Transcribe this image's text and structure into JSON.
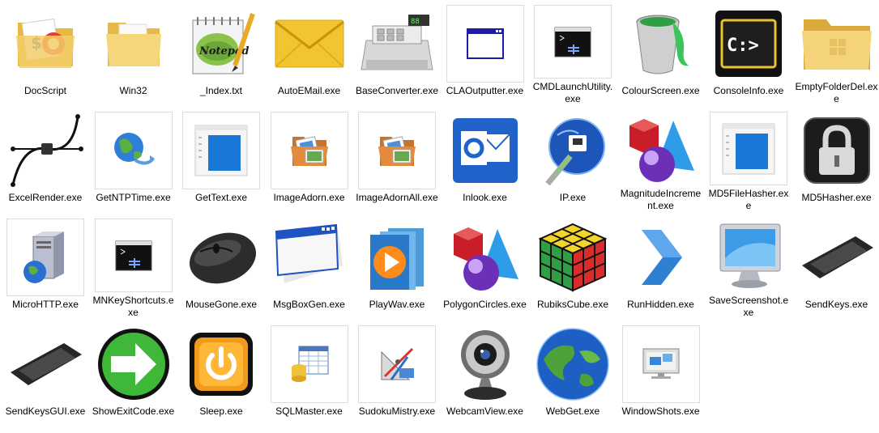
{
  "files": [
    {
      "name": "DocScript",
      "icon": "folder-with-documents-icon"
    },
    {
      "name": "Win32",
      "icon": "folder-icon"
    },
    {
      "name": "_Index.txt",
      "icon": "notepad-plus-plus-icon"
    },
    {
      "name": "AutoEMail.exe",
      "icon": "envelope-icon"
    },
    {
      "name": "BaseConverter.exe",
      "icon": "cash-register-icon"
    },
    {
      "name": "CLAOutputter.exe",
      "icon": "window-icon"
    },
    {
      "name": "CMDLaunchUtility.exe",
      "icon": "console-window-icon"
    },
    {
      "name": "ColourScreen.exe",
      "icon": "paint-bucket-icon"
    },
    {
      "name": "ConsoleInfo.exe",
      "icon": "command-prompt-icon"
    },
    {
      "name": "EmptyFolderDel.exe",
      "icon": "yellow-folder-icon"
    },
    {
      "name": "ExcelRender.exe",
      "icon": "bezier-curve-icon"
    },
    {
      "name": "GetNTPTime.exe",
      "icon": "globe-network-icon"
    },
    {
      "name": "GetText.exe",
      "icon": "application-window-icon"
    },
    {
      "name": "ImageAdorn.exe",
      "icon": "photo-folder-icon"
    },
    {
      "name": "ImageAdornAll.exe",
      "icon": "photo-folder-icon"
    },
    {
      "name": "Inlook.exe",
      "icon": "outlook-icon"
    },
    {
      "name": "IP.exe",
      "icon": "network-cable-globe-icon"
    },
    {
      "name": "MagnitudeIncrement.exe",
      "icon": "geometric-shapes-icon"
    },
    {
      "name": "MD5FileHasher.exe",
      "icon": "application-window-icon"
    },
    {
      "name": "MD5Hasher.exe",
      "icon": "padlock-icon"
    },
    {
      "name": "MicroHTTP.exe",
      "icon": "web-server-icon"
    },
    {
      "name": "MNKeyShortcuts.exe",
      "icon": "console-window-icon"
    },
    {
      "name": "MouseGone.exe",
      "icon": "mouse-icon"
    },
    {
      "name": "MsgBoxGen.exe",
      "icon": "message-box-icon"
    },
    {
      "name": "PlayWav.exe",
      "icon": "media-player-icon"
    },
    {
      "name": "PolygonCircles.exe",
      "icon": "geometric-shapes-icon"
    },
    {
      "name": "RubiksCube.exe",
      "icon": "rubiks-cube-icon"
    },
    {
      "name": "RunHidden.exe",
      "icon": "chevron-right-icon"
    },
    {
      "name": "SaveScreenshot.exe",
      "icon": "monitor-icon"
    },
    {
      "name": "SendKeys.exe",
      "icon": "keyboard-icon"
    },
    {
      "name": "SendKeysGUI.exe",
      "icon": "keyboard-icon"
    },
    {
      "name": "ShowExitCode.exe",
      "icon": "green-arrow-icon"
    },
    {
      "name": "Sleep.exe",
      "icon": "power-button-icon"
    },
    {
      "name": "SQLMaster.exe",
      "icon": "database-table-icon"
    },
    {
      "name": "SudokuMistry.exe",
      "icon": "drafting-tools-icon"
    },
    {
      "name": "WebcamView.exe",
      "icon": "webcam-icon"
    },
    {
      "name": "WebGet.exe",
      "icon": "earth-globe-icon"
    },
    {
      "name": "WindowShots.exe",
      "icon": "window-screenshot-icon"
    }
  ]
}
